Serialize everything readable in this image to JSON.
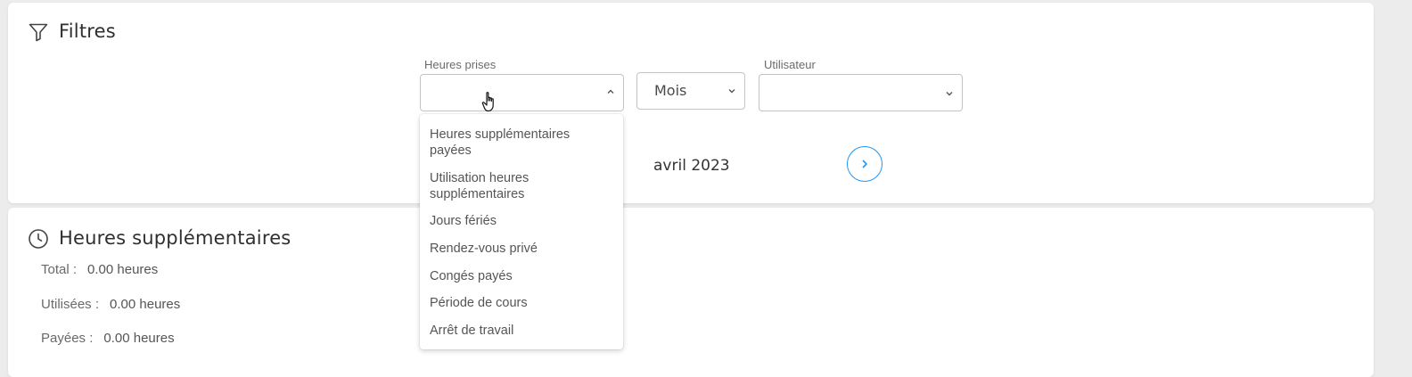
{
  "filters": {
    "title": "Filtres",
    "title_icon": "filter-icon",
    "hours_taken": {
      "label": "Heures prises",
      "value": "",
      "open": true,
      "options": [
        "Heures supplémentaires payées",
        "Utilisation heures supplémentaires",
        "Jours fériés",
        "Rendez-vous privé",
        "Congés payés",
        "Période de cours",
        "Arrêt de travail"
      ]
    },
    "period": {
      "value": "Mois"
    },
    "user": {
      "label": "Utilisateur",
      "value": ""
    },
    "current_period": "avril 2023",
    "next_icon": "chevron-right-icon",
    "accent_color": "#2196f3"
  },
  "overtime": {
    "title": "Heures supplémentaires",
    "title_icon": "clock-icon",
    "total_label": "Total :",
    "total_value": "0.00 heures",
    "used_label": "Utilisées :",
    "used_value": "0.00 heures",
    "paid_label": "Payées :",
    "paid_value": "0.00 heures"
  }
}
